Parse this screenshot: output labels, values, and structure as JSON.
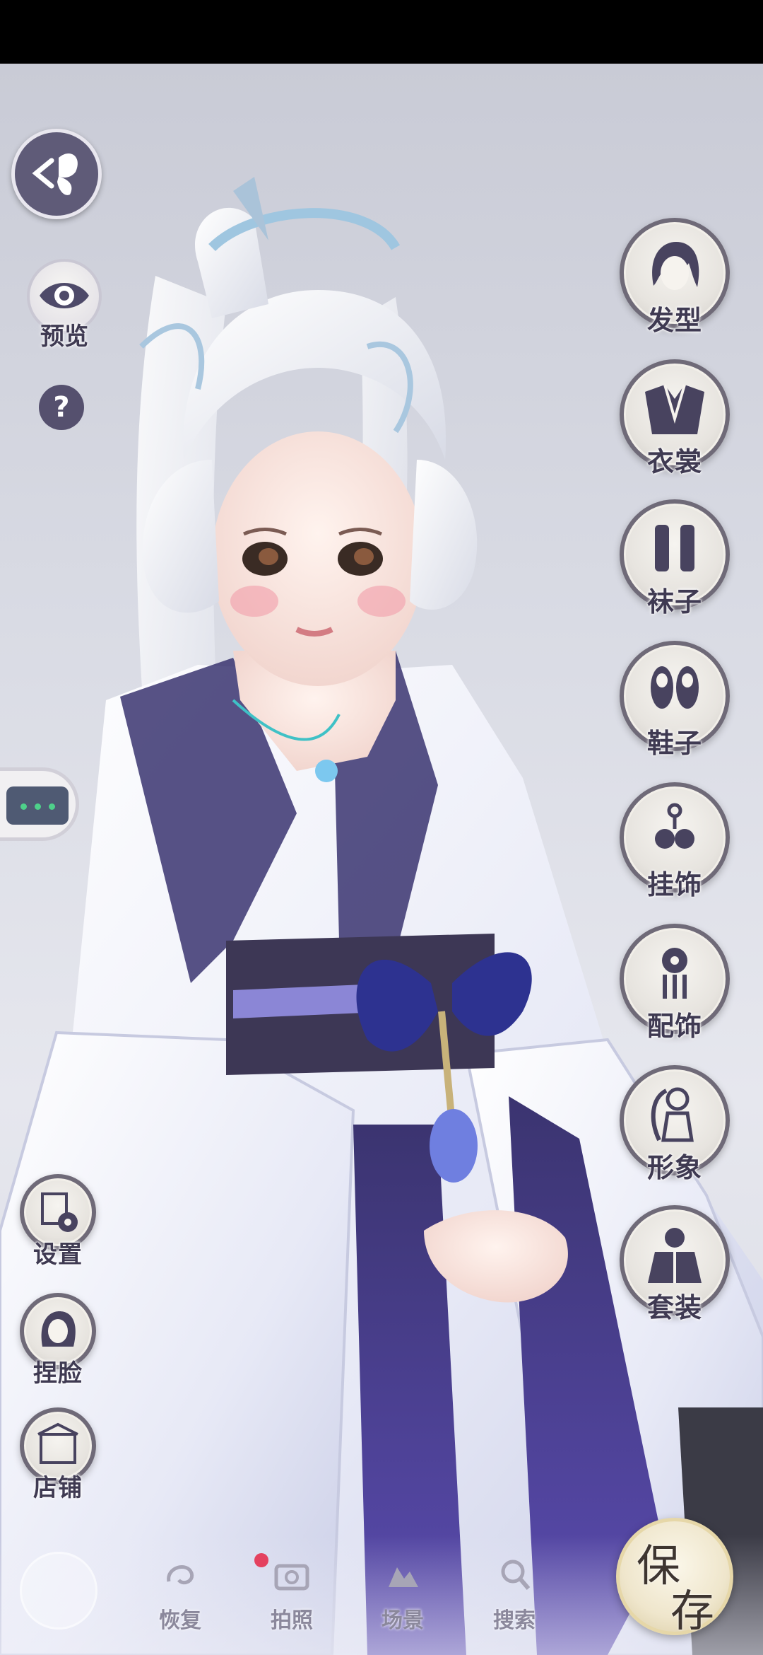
{
  "left_menu": {
    "preview_label": "预览",
    "help_label": "?",
    "settings_label": "设置",
    "face_label": "捏脸",
    "shop_label": "店铺"
  },
  "right_menu": {
    "hair_label": "发型",
    "clothes_label": "衣裳",
    "socks_label": "袜子",
    "shoes_label": "鞋子",
    "pendant_label": "挂饰",
    "accessory_label": "配饰",
    "appearance_label": "形象",
    "outfit_label": "套装"
  },
  "bottom_bar": {
    "restore_label": "恢复",
    "photo_label": "拍照",
    "scene_label": "场景",
    "search_label": "搜索"
  },
  "save": {
    "char1": "保",
    "char2": "存"
  },
  "colors": {
    "accent_purple": "#5f5b78",
    "label_text": "#3f3a52",
    "notification_red": "#e4415f",
    "save_gold": "#e6d7a8"
  }
}
